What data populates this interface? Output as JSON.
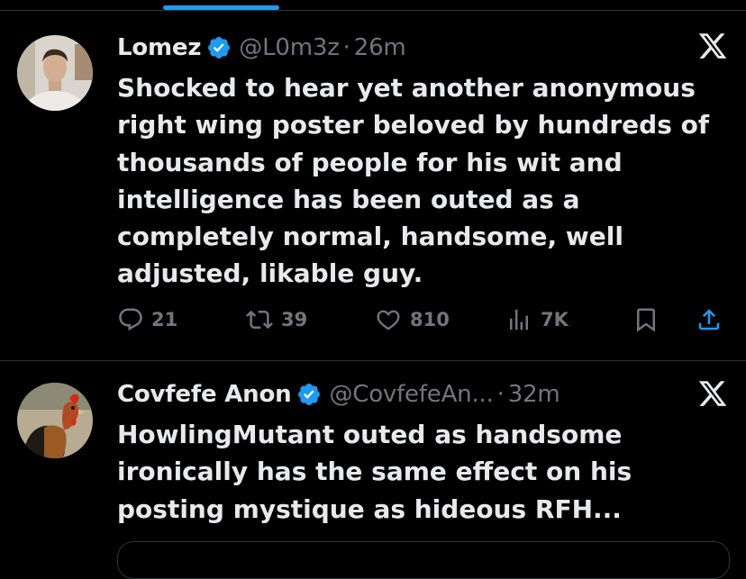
{
  "posts": [
    {
      "author": "Lomez",
      "handle": "@L0m3z",
      "separator": "·",
      "time": "26m",
      "text": "Shocked to hear yet another anonymous right wing poster beloved by hundreds of thousands of people for his wit and intelligence has been outed as a completely normal, handsome, well adjusted, likable guy.",
      "replies": "21",
      "reposts": "39",
      "likes": "810",
      "views": "7K"
    },
    {
      "author": "Covfefe Anon",
      "handle": "@CovfefeAn...",
      "separator": "·",
      "time": "32m",
      "text": "HowlingMutant outed as handsome ironically has the same effect on his posting mystique as hideous RFH..."
    }
  ],
  "colors": {
    "background": "#000000",
    "text": "#e7e9ea",
    "muted": "#71767b",
    "accent": "#1d9bf0",
    "divider": "#2f3336"
  },
  "icons": [
    "verified-badge-icon",
    "x-logo-icon",
    "reply-icon",
    "repost-icon",
    "like-icon",
    "views-icon",
    "bookmark-icon",
    "share-icon"
  ]
}
